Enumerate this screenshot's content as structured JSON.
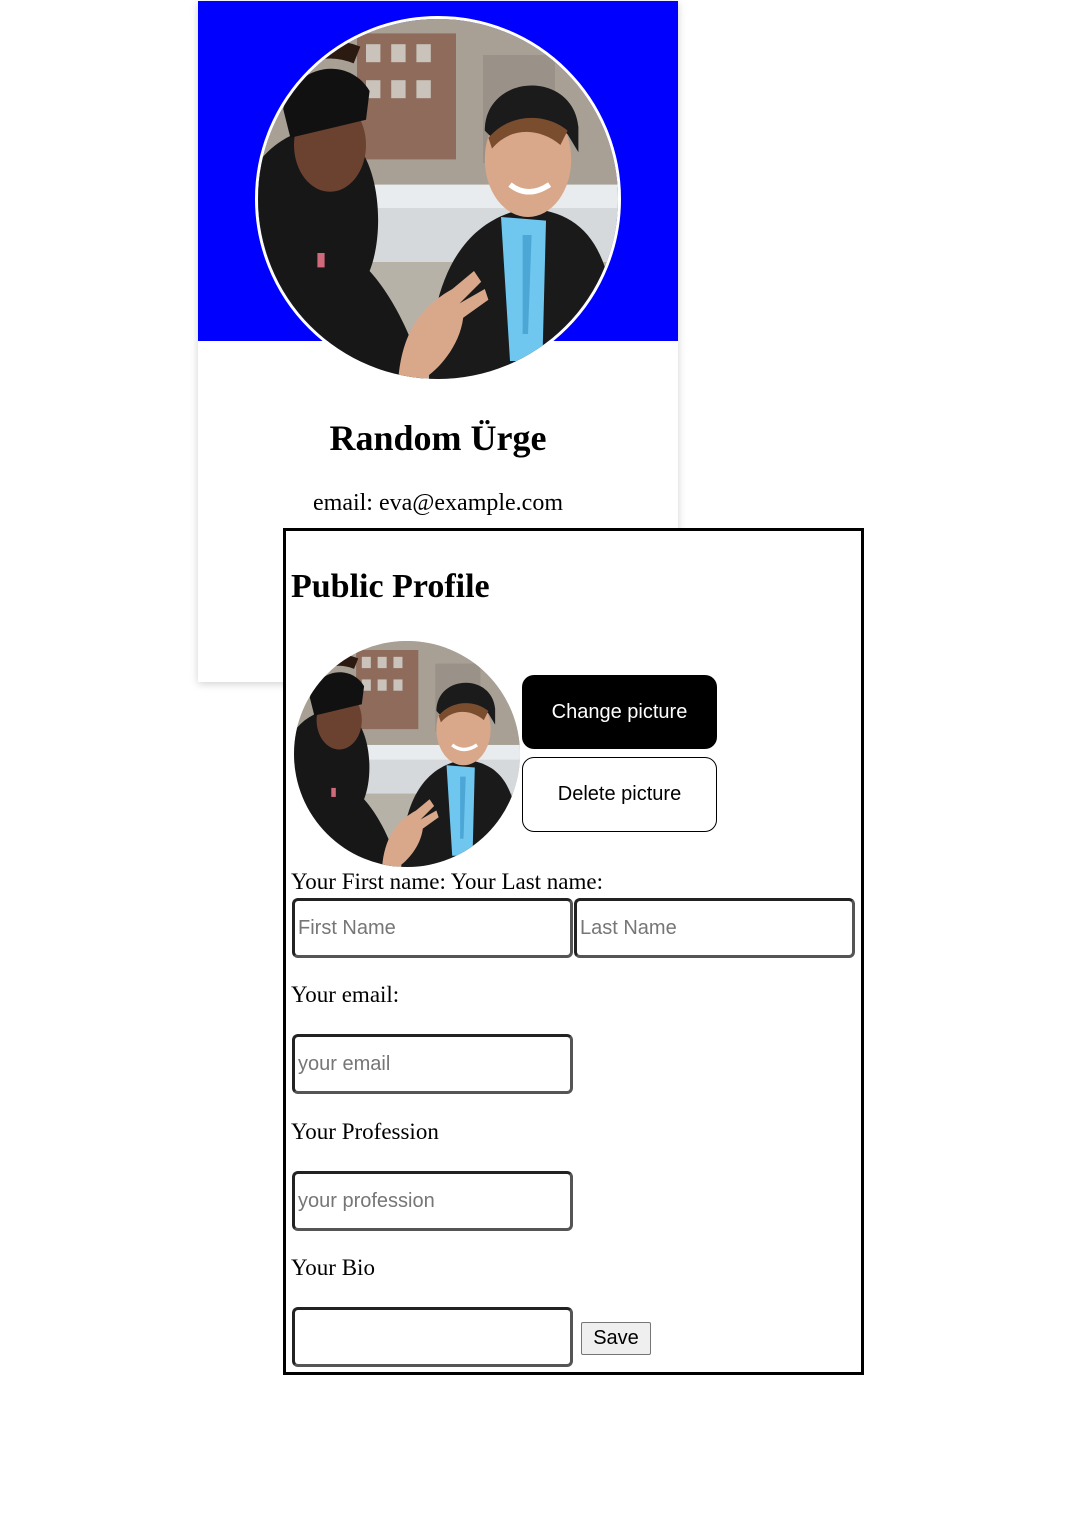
{
  "colors": {
    "cover": "#0000ff",
    "primary_button": "#000000",
    "panel_border": "#000000"
  },
  "card": {
    "name": "Random Ürge",
    "email": "email: eva@example.com",
    "avatar": "profile-photo"
  },
  "form": {
    "title": "Public Profile",
    "change_picture": "Change picture",
    "delete_picture": "Delete picture",
    "name_label": "Your First name: Your Last name:",
    "first_name": {
      "placeholder": "First Name",
      "value": ""
    },
    "last_name": {
      "placeholder": "Last Name",
      "value": ""
    },
    "email_label": "Your email:",
    "email": {
      "placeholder": "your email",
      "value": ""
    },
    "profession_label": "Your Profession",
    "profession": {
      "placeholder": "your profession",
      "value": ""
    },
    "bio_label": "Your Bio",
    "bio": {
      "placeholder": "",
      "value": ""
    },
    "save": "Save"
  }
}
